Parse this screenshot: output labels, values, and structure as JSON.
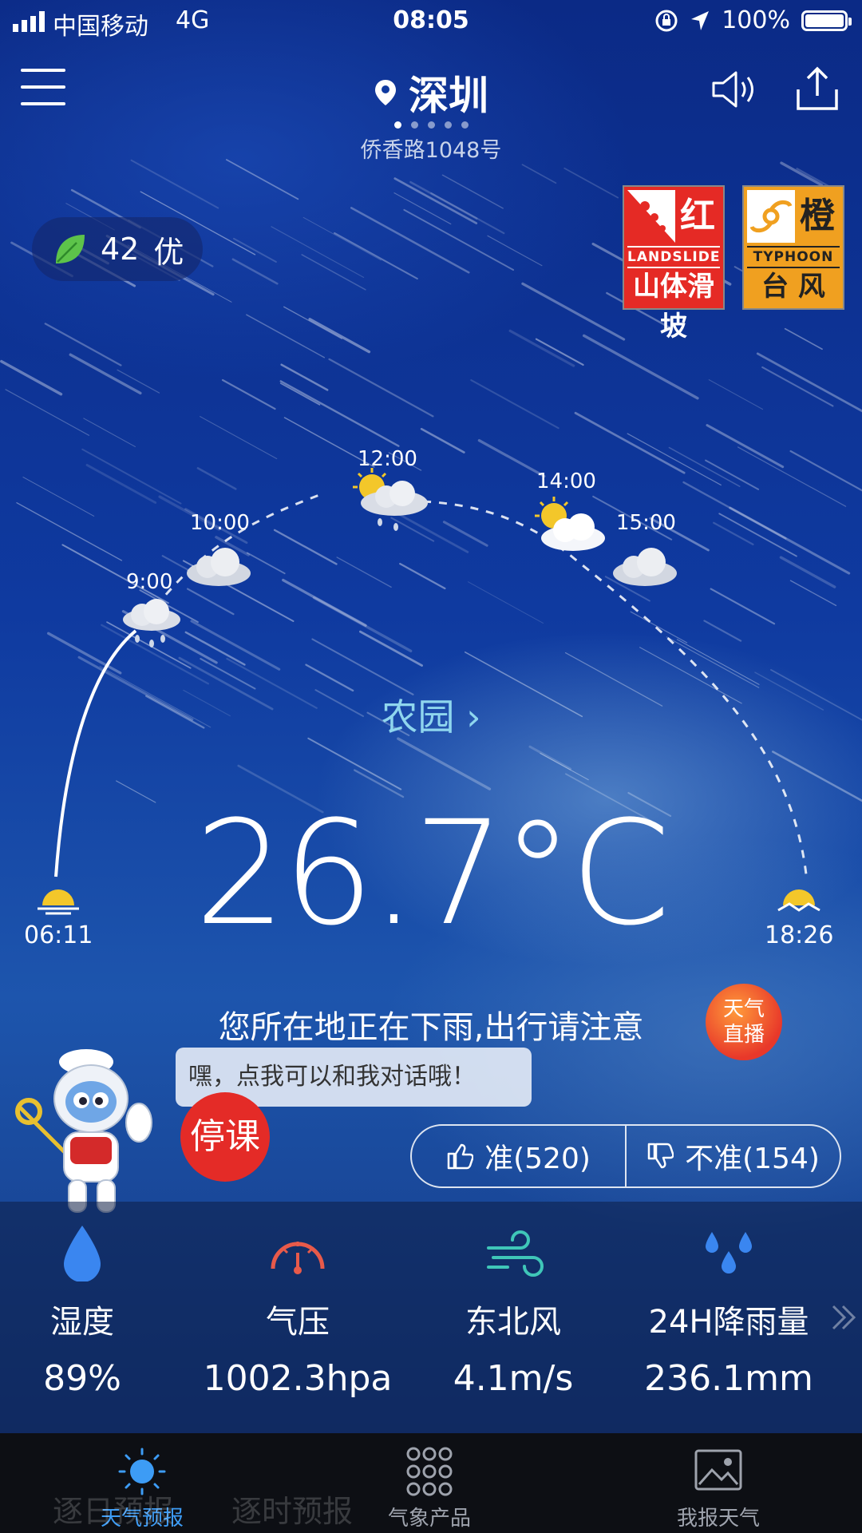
{
  "status_bar": {
    "carrier": "中国移动",
    "network": "4G",
    "time": "08:05",
    "battery": "100%"
  },
  "header": {
    "city": "深圳",
    "street": "侨香路1048号",
    "page_dots": 5,
    "active_dot": 0
  },
  "aqi": {
    "value": "42",
    "level": "优"
  },
  "warnings": [
    {
      "level": "红",
      "en": "LANDSLIDE",
      "cn": "山体滑坡",
      "color": "#e52a25"
    },
    {
      "level": "橙",
      "en": "TYPHOON",
      "cn": "台 风",
      "color": "#f0a020"
    }
  ],
  "hourly": [
    {
      "time": "9:00",
      "icon": "cloud-rain-icon"
    },
    {
      "time": "10:00",
      "icon": "cloud-icon"
    },
    {
      "time": "12:00",
      "icon": "sun-cloud-rain-icon"
    },
    {
      "time": "14:00",
      "icon": "sun-cloud-icon"
    },
    {
      "time": "15:00",
      "icon": "cloud-icon"
    }
  ],
  "station": {
    "name": "农园",
    "chevron": "›"
  },
  "current": {
    "temperature": "26.7°C"
  },
  "sun": {
    "sunrise": "06:11",
    "sunset": "18:26"
  },
  "notice": "您所在地正在下雨,出行请注意",
  "live_button": {
    "line1": "天气",
    "line2": "直播"
  },
  "assistant": {
    "bubble": "嘿，点我可以和我对话哦！",
    "stop_class": "停课"
  },
  "vote": {
    "accurate": "准(520)",
    "inaccurate": "不准(154)"
  },
  "stats": [
    {
      "label": "湿度",
      "value": "89%",
      "icon": "water-drop-icon"
    },
    {
      "label": "气压",
      "value": "1002.3hpa",
      "icon": "gauge-icon"
    },
    {
      "label": "东北风",
      "value": "4.1m/s",
      "icon": "wind-icon"
    },
    {
      "label": "24H降雨量",
      "value": "236.1mm",
      "icon": "raindrops-icon"
    }
  ],
  "tabs": [
    {
      "label": "天气预报",
      "active": true
    },
    {
      "label": "气象产品",
      "active": false
    },
    {
      "label": "我报天气",
      "active": false
    }
  ],
  "ghost_tabs": [
    "逐日预报",
    "逐时预报"
  ],
  "colors": {
    "accent": "#3d9cf5",
    "live": "#e8382a",
    "stop": "#e42b27",
    "station": "#8fd6ee"
  }
}
